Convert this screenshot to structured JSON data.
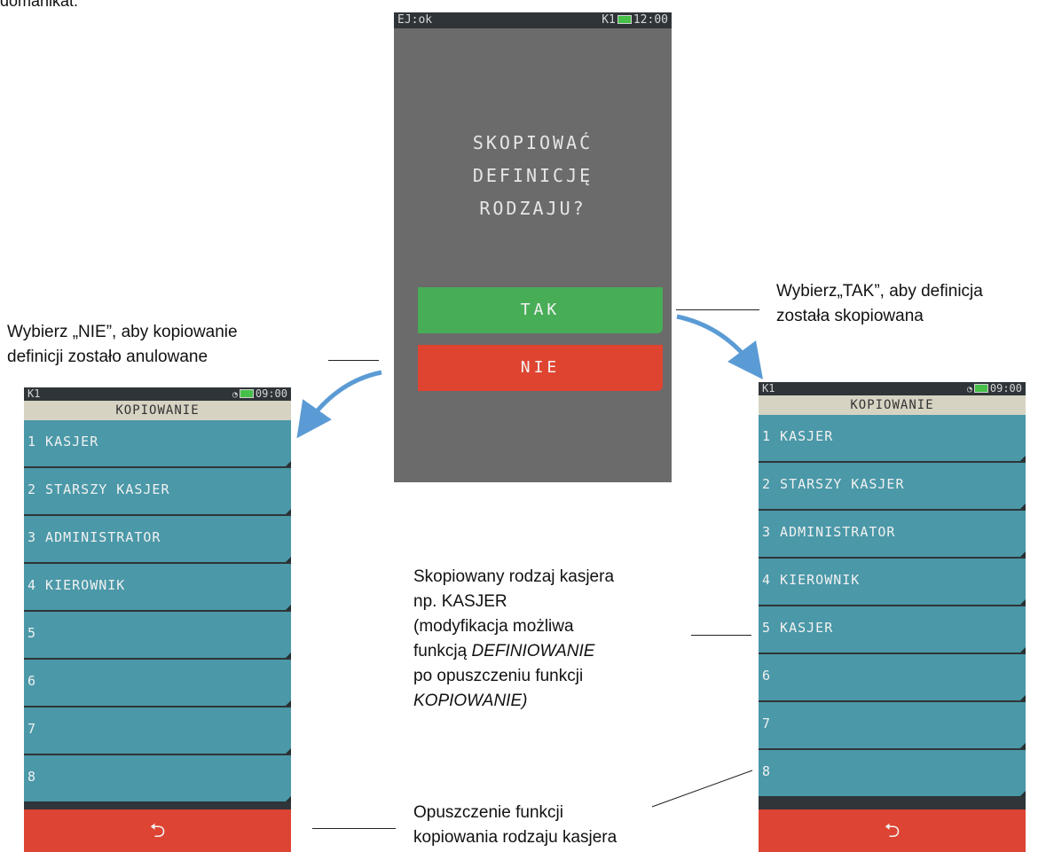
{
  "top_cut_text": "domanikat.",
  "dialog": {
    "status_left": "EJ:ok",
    "status_right": "K1",
    "time": "12:00",
    "question_lines": [
      "SKOPIOWAĆ",
      "DEFINICJĘ",
      "RODZAJU?"
    ],
    "yes_label": "TAK",
    "no_label": "NIE"
  },
  "left_phone": {
    "status_left": "K1",
    "time": "09:00",
    "title": "KOPIOWANIE",
    "items": [
      "1 KASJER",
      "2 STARSZY KASJER",
      "3 ADMINISTRATOR",
      "4 KIEROWNIK",
      "5",
      "6",
      "7",
      "8"
    ],
    "back_glyph": "⮌"
  },
  "right_phone": {
    "status_left": "K1",
    "time": "09:00",
    "title": "KOPIOWANIE",
    "items": [
      "1 KASJER",
      "2 STARSZY KASJER",
      "3 ADMINISTRATOR",
      "4 KIEROWNIK",
      "5 KASJER",
      "6",
      "7",
      "8"
    ],
    "back_glyph": "⮌"
  },
  "notes": {
    "nie_line1": "Wybierz „NIE”, aby kopiowanie",
    "nie_line2": "definicji zostało anulowane",
    "tak_line1": "Wybierz„TAK”, aby definicja",
    "tak_line2": "została skopiowana",
    "copied_1": "Skopiowany rodzaj kasjera",
    "copied_2": "np. KASJER",
    "copied_3": "(modyfikacja możliwa",
    "copied_4a": "funkcją ",
    "copied_4b": "DEFINIOWANIE",
    "copied_5": "po opuszczeniu funkcji",
    "copied_6": "KOPIOWANIE)",
    "exit_1": "Opuszczenie funkcji",
    "exit_2": "kopiowania rodzaju kasjera"
  },
  "colors": {
    "arrow": "#5b9bd5",
    "yes": "#48ad57",
    "no": "#df4431",
    "list_item": "#4a98a8"
  }
}
